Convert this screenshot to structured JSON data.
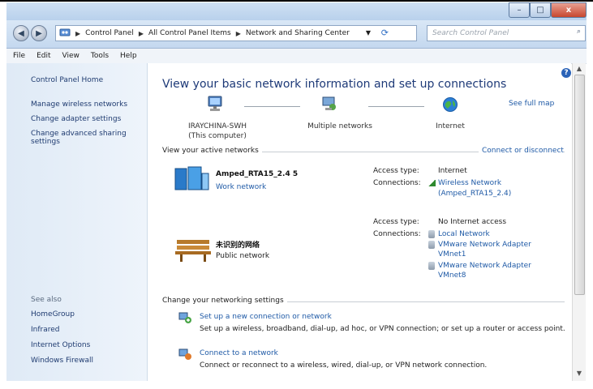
{
  "window": {
    "controls": {
      "minimize": "–",
      "maximize": "□",
      "close": "x"
    }
  },
  "address": {
    "back": "◀",
    "forward": "▶",
    "crumbs": [
      "Control Panel",
      "All Control Panel Items",
      "Network and Sharing Center"
    ],
    "refresh": "⟳",
    "search_placeholder": "Search Control Panel",
    "search_icon": "⌕"
  },
  "menu": {
    "items": [
      "File",
      "Edit",
      "View",
      "Tools",
      "Help"
    ]
  },
  "sidebar": {
    "home": "Control Panel Home",
    "links": [
      "Manage wireless networks",
      "Change adapter settings",
      "Change advanced sharing settings"
    ],
    "see_also": "See also",
    "see_also_links": [
      "HomeGroup",
      "Infrared",
      "Internet Options",
      "Windows Firewall"
    ]
  },
  "main": {
    "headline": "View your basic network information and set up connections",
    "help": "?",
    "see_full_map": "See full map",
    "map": {
      "computer": "IRAYCHINA-SWH",
      "computer_sub": "(This computer)",
      "multiple": "Multiple networks",
      "internet": "Internet"
    },
    "active_networks_title": "View your active networks",
    "connect_disconnect": "Connect or disconnect",
    "networks": [
      {
        "name": "Amped_RTA15_2.4  5",
        "type": "Work network",
        "access_label": "Access type:",
        "access_value": "Internet",
        "connections_label": "Connections:",
        "connections": [
          "Wireless Network",
          "(Amped_RTA15_2.4)"
        ]
      },
      {
        "name": "未识别的网络",
        "type": "Public network",
        "access_label": "Access type:",
        "access_value": "No Internet access",
        "connections_label": "Connections:",
        "connections": [
          "Local Network",
          "VMware Network Adapter",
          "VMnet1",
          "VMware Network Adapter",
          "VMnet8"
        ]
      }
    ],
    "change_settings_title": "Change your networking settings",
    "settings": [
      {
        "title": "Set up a new connection or network",
        "desc": "Set up a wireless, broadband, dial-up, ad hoc, or VPN connection; or set up a router or access point."
      },
      {
        "title": "Connect to a network",
        "desc": "Connect or reconnect to a wireless, wired, dial-up, or VPN network connection."
      }
    ]
  },
  "colors": {
    "link": "#1f5aa6",
    "headline": "#1e3a78",
    "sidebar_bg": "#dfeaf6"
  }
}
